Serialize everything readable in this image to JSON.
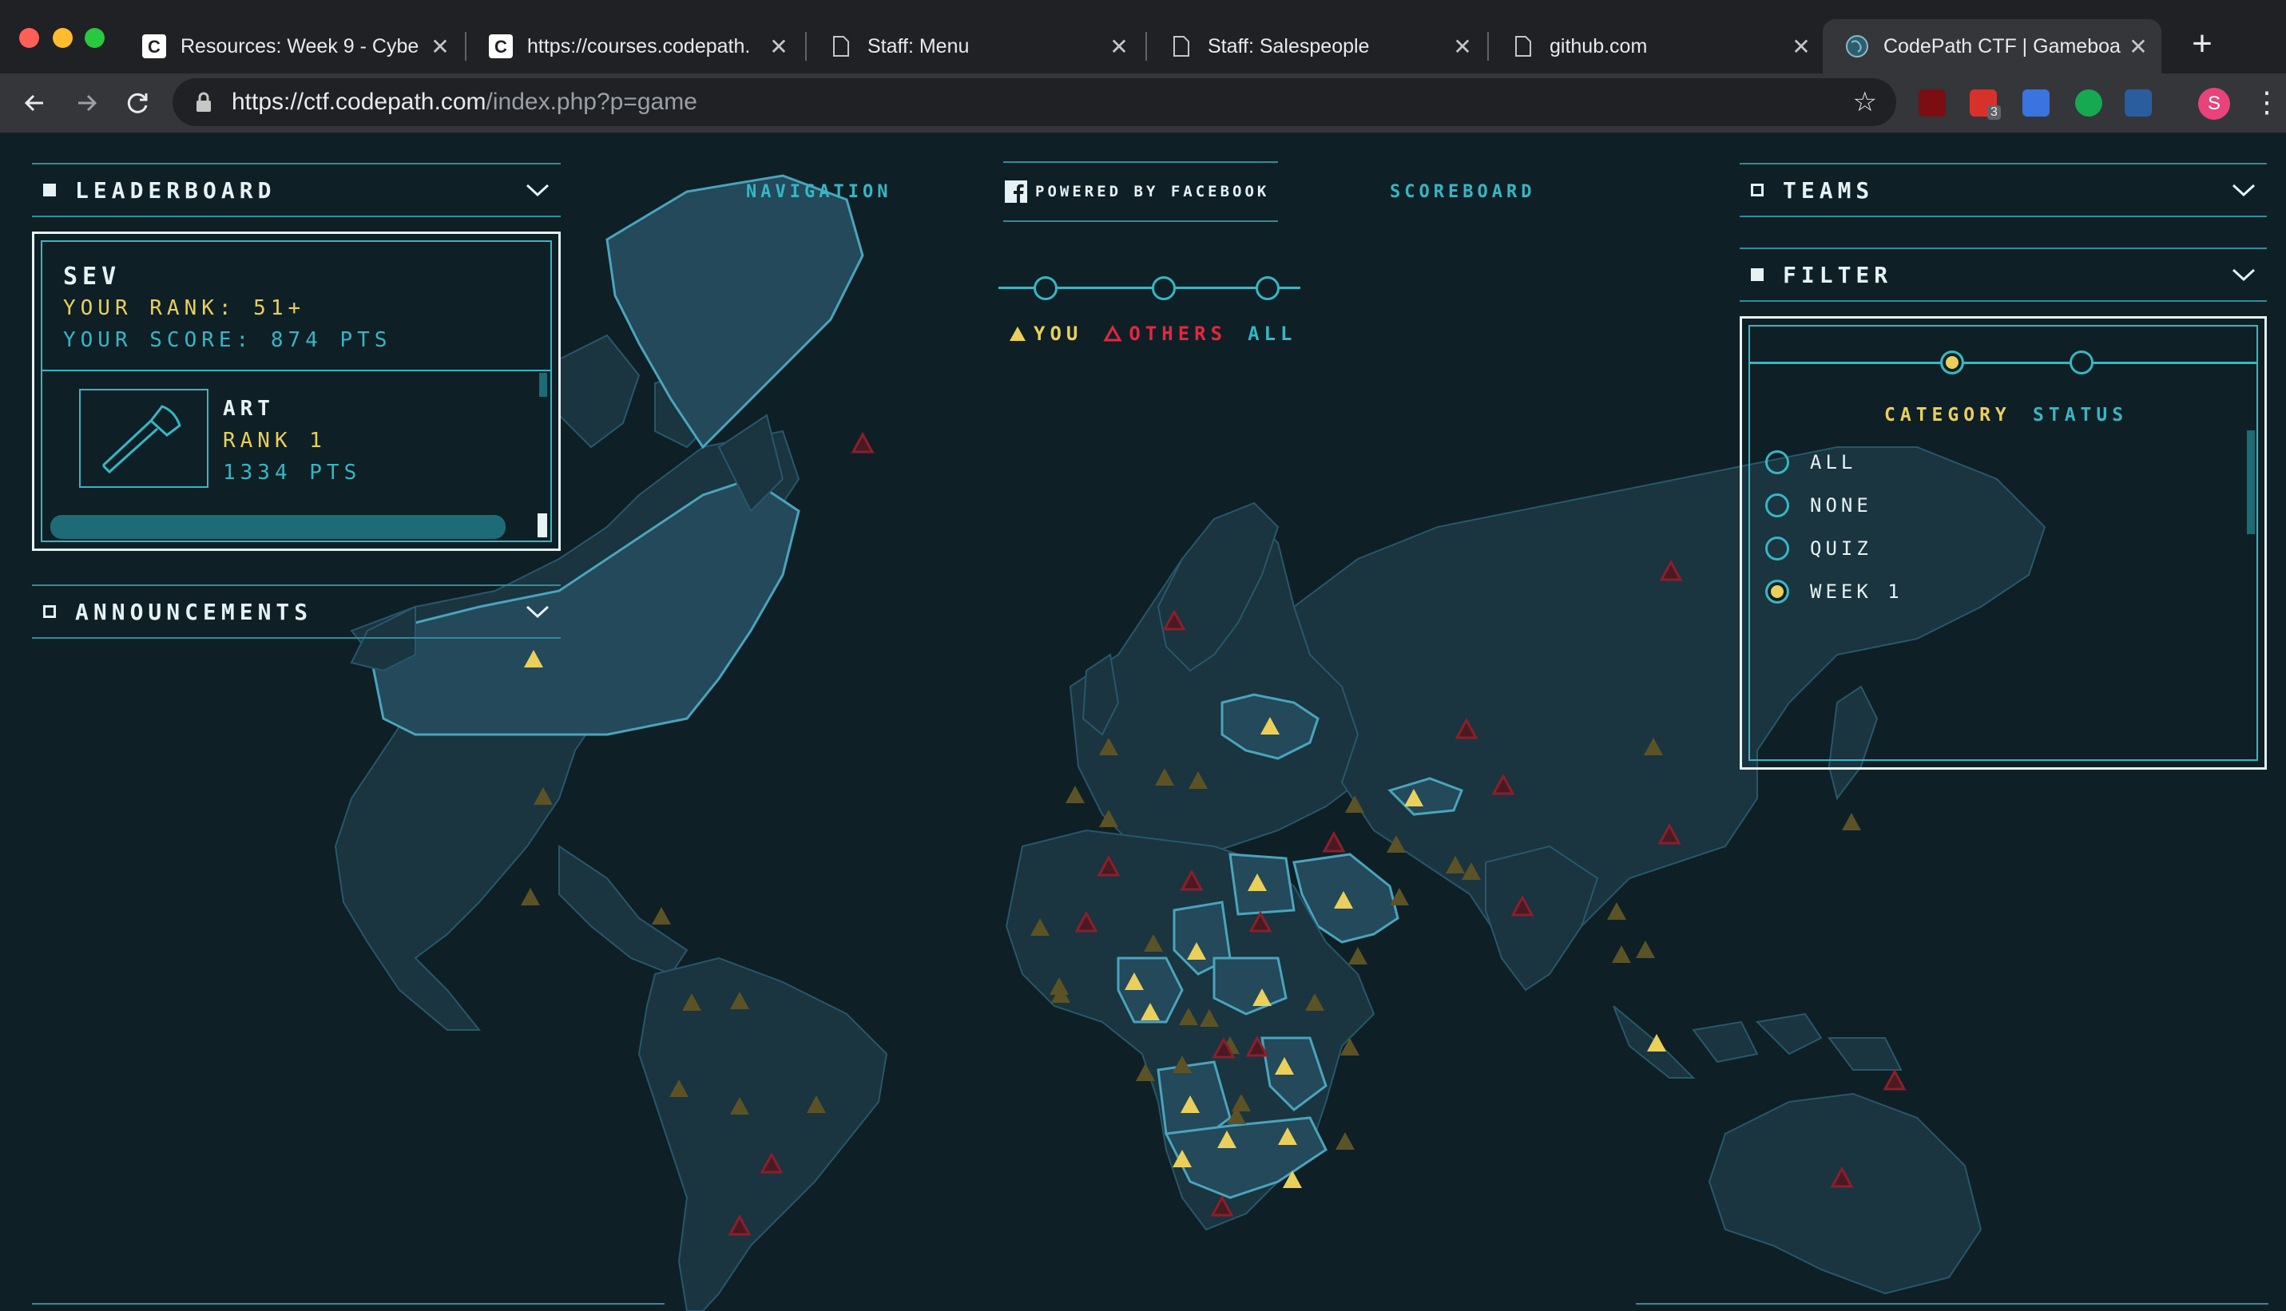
{
  "browser": {
    "tabs": [
      {
        "title": "Resources: Week 9 - Cybe",
        "favicon": "codepath-icon"
      },
      {
        "title": "https://courses.codepath.",
        "favicon": "codepath-icon"
      },
      {
        "title": "Staff: Menu",
        "favicon": "page-icon"
      },
      {
        "title": "Staff: Salespeople",
        "favicon": "page-icon"
      },
      {
        "title": "github.com",
        "favicon": "page-icon"
      },
      {
        "title": "CodePath CTF | Gameboa",
        "favicon": "globe-icon",
        "active": true
      }
    ],
    "new_tab": "+",
    "close": "✕",
    "url_host": "https://ctf.codepath.com",
    "url_path": "/index.php?p=game",
    "extension_badge": "3",
    "profile_initial": "S"
  },
  "game": {
    "leaderboard": {
      "title": "LEADERBOARD",
      "team": "SEV",
      "rank_text": "YOUR RANK: 51+",
      "score_text": "YOUR SCORE: 874  PTS",
      "entry": {
        "name": "ART",
        "rank": "RANK 1",
        "points": "1334 PTS",
        "icon": "axe-icon"
      }
    },
    "announcements": {
      "title": "ANNOUNCEMENTS"
    },
    "nav": {
      "navigation": "NAVIGATION",
      "powered": "POWERED BY FACEBOOK",
      "scoreboard": "SCOREBOARD"
    },
    "legend": {
      "you": "YOU",
      "others": "OTHERS",
      "all": "ALL"
    },
    "teams": {
      "title": "TEAMS"
    },
    "filter": {
      "title": "FILTER",
      "tabs": {
        "category": "CATEGORY",
        "status": "STATUS"
      },
      "options": [
        {
          "label": "ALL",
          "selected": false
        },
        {
          "label": "NONE",
          "selected": false
        },
        {
          "label": "QUIZ",
          "selected": false
        },
        {
          "label": "WEEK 1",
          "selected": true
        }
      ]
    },
    "colors": {
      "accent": "#35b7c4",
      "you": "#ead05a",
      "others": "#e4273d",
      "background": "#0f1f26"
    }
  }
}
